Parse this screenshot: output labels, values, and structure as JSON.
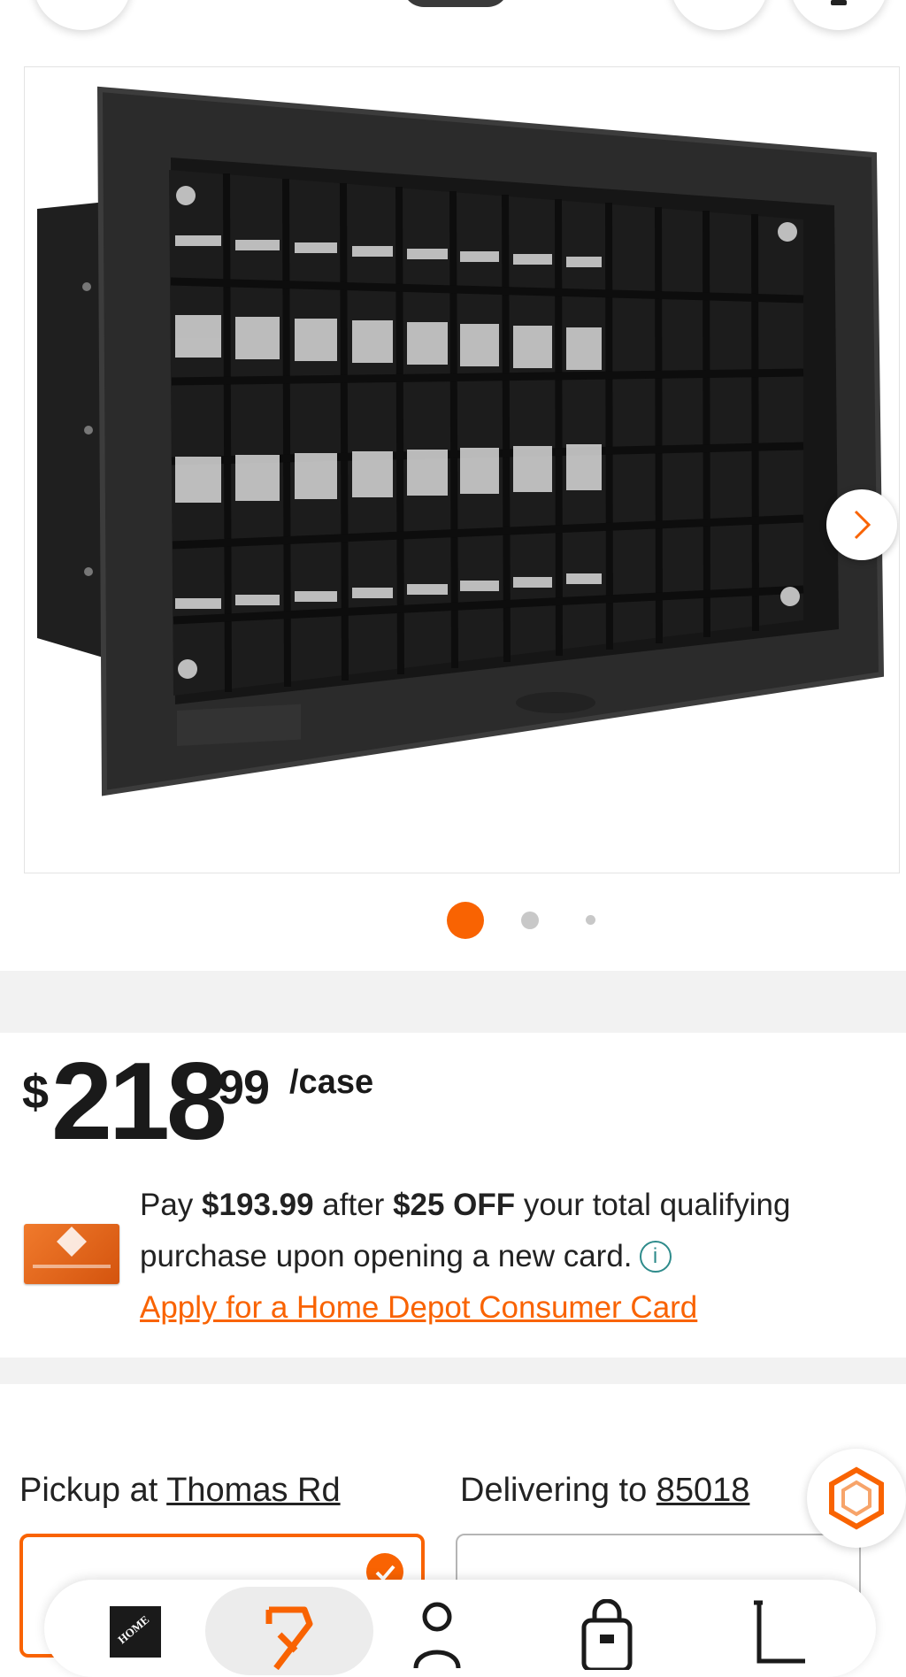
{
  "colors": {
    "brand_orange": "#f96302",
    "info_teal": "#2e8b8b",
    "text_dark": "#1a1a1a"
  },
  "top_bar": {
    "back_button_icon": "back-icon",
    "share_button_icon": "share-icon",
    "more_button_icon": "more-icon"
  },
  "product_image": {
    "current_index": 1,
    "total_images": 3,
    "next_icon": "chevron-right-icon"
  },
  "price": {
    "currency": "$",
    "dollars": "218",
    "cents": "99",
    "unit": "/case"
  },
  "card_offer": {
    "line1_pre": "Pay ",
    "line1_amount": "$193.99",
    "line1_mid": " after ",
    "line1_discount": "$25 OFF",
    "line1_post": " your total qualifying",
    "line2": "purchase upon opening a new card.",
    "link": "Apply for a Home Depot Consumer Card"
  },
  "fulfillment": {
    "pickup_prefix": "Pickup at ",
    "pickup_store": "Thomas Rd",
    "delivery_prefix": "Delivering to ",
    "delivery_zip": "85018"
  },
  "bottom_nav": {
    "items": [
      "home-logo-icon",
      "shop-icon",
      "account-icon",
      "lists-icon",
      "cart-icon"
    ],
    "active": "shop-icon"
  }
}
